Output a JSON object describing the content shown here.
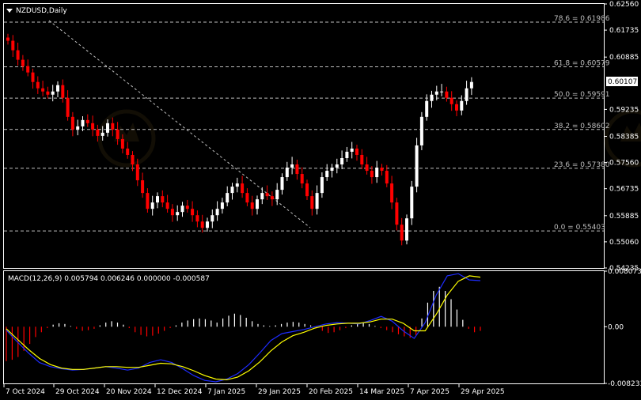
{
  "symbol_title": "NZDUSD,Daily",
  "macd_title": "MACD(12,26,9) 0.005794 0.006246 0.000000 -0.000587",
  "colors": {
    "background": "#000000",
    "grid": "#ffffff",
    "bull": "#ffffff",
    "bear": "#ff0000",
    "macd_line": "#1e2cff",
    "signal_line": "#ffff00",
    "fib_line": "#bfbfbf",
    "price_marker": "#ffffff"
  },
  "chart_data": [
    {
      "type": "candlestick",
      "title": "NZDUSD,Daily",
      "y_ticks": [
        "0.62560",
        "0.61735",
        "0.60885",
        "0.60107",
        "0.59235",
        "0.58385",
        "0.57560",
        "0.56735",
        "0.55885",
        "0.55060",
        "0.54235"
      ],
      "ylim": [
        0.54235,
        0.6256
      ],
      "current_price": "0.60107",
      "x_ticks": [
        "7 Oct 2024",
        "29 Oct 2024",
        "20 Nov 2024",
        "12 Dec 2024",
        "7 Jan 2025",
        "29 Jan 2025",
        "20 Feb 2025",
        "14 Mar 2025",
        "7 Apr 2025",
        "29 Apr 2025"
      ],
      "fibonacci": [
        {
          "label": "78.6 = 0.61986",
          "value": 0.61986
        },
        {
          "label": "61.8 = 0.60579",
          "value": 0.60579
        },
        {
          "label": "50.0 = 0.59591",
          "value": 0.59591
        },
        {
          "label": "38.2 = 0.58602",
          "value": 0.58602
        },
        {
          "label": "23.6 = 0.57380",
          "value": 0.5738
        },
        {
          "label": "0.0 = 0.55403",
          "value": 0.55403
        }
      ],
      "close_path": [
        0.614,
        0.611,
        0.608,
        0.606,
        0.604,
        0.601,
        0.599,
        0.598,
        0.597,
        0.598,
        0.6,
        0.596,
        0.59,
        0.586,
        0.587,
        0.589,
        0.588,
        0.586,
        0.584,
        0.585,
        0.588,
        0.586,
        0.583,
        0.58,
        0.578,
        0.575,
        0.57,
        0.566,
        0.561,
        0.563,
        0.565,
        0.563,
        0.561,
        0.559,
        0.56,
        0.562,
        0.561,
        0.559,
        0.557,
        0.555,
        0.557,
        0.559,
        0.561,
        0.563,
        0.566,
        0.568,
        0.569,
        0.566,
        0.563,
        0.561,
        0.564,
        0.566,
        0.565,
        0.564,
        0.567,
        0.571,
        0.574,
        0.575,
        0.572,
        0.569,
        0.565,
        0.561,
        0.566,
        0.571,
        0.573,
        0.574,
        0.575,
        0.577,
        0.579,
        0.58,
        0.578,
        0.575,
        0.573,
        0.571,
        0.574,
        0.573,
        0.569,
        0.563,
        0.556,
        0.551,
        0.558,
        0.568,
        0.581,
        0.59,
        0.595,
        0.597,
        0.598,
        0.598,
        0.596,
        0.594,
        0.592,
        0.595,
        0.599,
        0.601
      ]
    },
    {
      "type": "macd",
      "title": "MACD(12,26,9)",
      "y_ticks": [
        "0.008073",
        "0.00",
        "-0.008233"
      ],
      "ylim": [
        -0.008233,
        0.008073
      ],
      "histogram": [
        -0.005,
        -0.0048,
        -0.0044,
        -0.0035,
        -0.0025,
        -0.0015,
        -0.0008,
        -0.0002,
        0.0003,
        0.0005,
        0.0004,
        0.0001,
        -0.0003,
        -0.0006,
        -0.0005,
        -0.0003,
        0.0002,
        0.0006,
        0.0008,
        0.0006,
        0.0003,
        -0.0002,
        -0.0008,
        -0.0012,
        -0.0014,
        -0.0013,
        -0.001,
        -0.0006,
        -0.0002,
        0.0002,
        0.0006,
        0.0009,
        0.0011,
        0.0012,
        0.0011,
        0.0009,
        0.0006,
        0.0012,
        0.0016,
        0.0019,
        0.0017,
        0.0013,
        0.0008,
        0.0004,
        0.0002,
        0.0001,
        0.0002,
        0.0004,
        0.0006,
        0.0007,
        0.0006,
        0.0004,
        0.0002,
        -0.0002,
        -0.0006,
        -0.0009,
        -0.0008,
        -0.0005,
        -0.0002,
        0.0002,
        0.0005,
        0.0006,
        0.0004,
        0.0001,
        -0.0002,
        -0.0005,
        -0.0008,
        -0.0011,
        -0.0014,
        -0.0016,
        -0.0012,
        0.0012,
        0.0035,
        0.0052,
        0.0058,
        0.0052,
        0.004,
        0.0025,
        0.001,
        -0.0003,
        -0.0008,
        -0.0006
      ],
      "macd": [
        -0.0005,
        -0.0022,
        -0.0038,
        -0.0052,
        -0.0058,
        -0.0061,
        -0.0063,
        -0.0062,
        -0.006,
        -0.0058,
        -0.006,
        -0.0063,
        -0.006,
        -0.0052,
        -0.0048,
        -0.0052,
        -0.0061,
        -0.0071,
        -0.0078,
        -0.008,
        -0.0076,
        -0.0068,
        -0.0055,
        -0.0038,
        -0.002,
        -0.001,
        -0.0007,
        -0.0004,
        0.0,
        0.0004,
        0.0006,
        0.0005,
        0.0004,
        0.0009,
        0.0015,
        0.0008,
        -0.0006,
        -0.0017,
        0.0006,
        0.0046,
        0.0074,
        0.0077,
        0.0068,
        0.0067
      ],
      "signal": [
        -0.0003,
        -0.0018,
        -0.0033,
        -0.0046,
        -0.0055,
        -0.006,
        -0.0062,
        -0.0062,
        -0.006,
        -0.0058,
        -0.0058,
        -0.0059,
        -0.0059,
        -0.0056,
        -0.0053,
        -0.0054,
        -0.0058,
        -0.0064,
        -0.0071,
        -0.0076,
        -0.0077,
        -0.0073,
        -0.0064,
        -0.0051,
        -0.0035,
        -0.0022,
        -0.0013,
        -0.0008,
        -0.0002,
        0.0002,
        0.0004,
        0.0005,
        0.0005,
        0.0007,
        0.0011,
        0.0011,
        0.0005,
        -0.0006,
        -0.0006,
        0.0018,
        0.0046,
        0.0066,
        0.0074,
        0.0072
      ]
    }
  ]
}
